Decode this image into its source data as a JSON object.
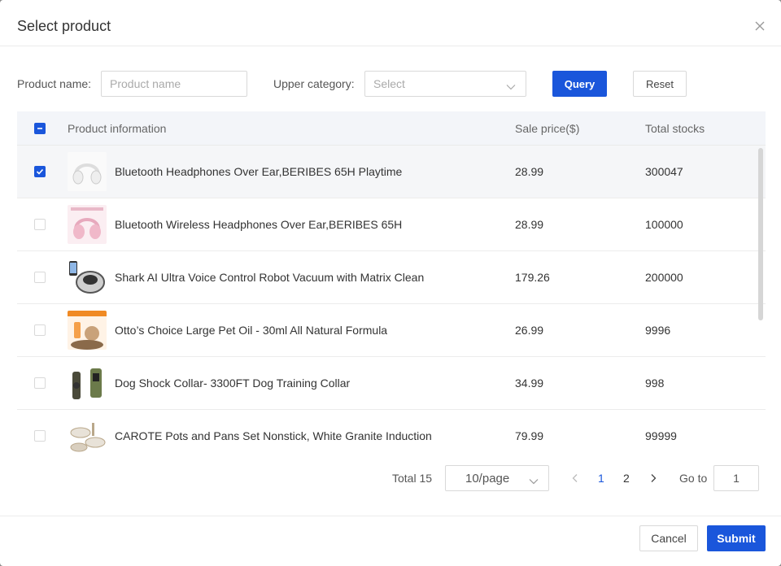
{
  "modal": {
    "title": "Select product",
    "close_icon": "close-icon"
  },
  "filters": {
    "product_name_label": "Product name:",
    "product_name_placeholder": "Product name",
    "product_name_value": "",
    "upper_category_label": "Upper category:",
    "upper_category_placeholder": "Select",
    "query_label": "Query",
    "reset_label": "Reset"
  },
  "table": {
    "columns": [
      "Product information",
      "Sale price($)",
      "Total stocks"
    ],
    "header_checkbox_state": "indeterminate",
    "rows": [
      {
        "name": "Bluetooth Headphones Over Ear,BERIBES 65H Playtime",
        "price": "28.99",
        "stock": "300047",
        "checked": true,
        "thumb": "white-headphones"
      },
      {
        "name": "Bluetooth Wireless Headphones Over Ear,BERIBES 65H",
        "price": "28.99",
        "stock": "100000",
        "checked": false,
        "thumb": "pink-headphones"
      },
      {
        "name": "Shark AI Ultra Voice Control Robot Vacuum with Matrix Clean",
        "price": "179.26",
        "stock": "200000",
        "checked": false,
        "thumb": "robot-vacuum"
      },
      {
        "name": "Otto’s Choice Large Pet Oil - 30ml All Natural Formula",
        "price": "26.99",
        "stock": "9996",
        "checked": false,
        "thumb": "pet-oil"
      },
      {
        "name": "Dog Shock Collar- 3300FT Dog Training Collar",
        "price": "34.99",
        "stock": "998",
        "checked": false,
        "thumb": "dog-collar"
      },
      {
        "name": "CAROTE Pots and Pans Set Nonstick, White Granite Induction",
        "price": "79.99",
        "stock": "99999",
        "checked": false,
        "thumb": "pots-pans"
      }
    ]
  },
  "pagination": {
    "total_label": "Total 15",
    "page_size_label": "10/page",
    "pages": [
      "1",
      "2"
    ],
    "current_page": "1",
    "goto_label": "Go to",
    "goto_value": "1"
  },
  "footer": {
    "cancel_label": "Cancel",
    "submit_label": "Submit"
  },
  "colors": {
    "primary": "#1a56db",
    "header_bg": "#f3f5f9"
  }
}
